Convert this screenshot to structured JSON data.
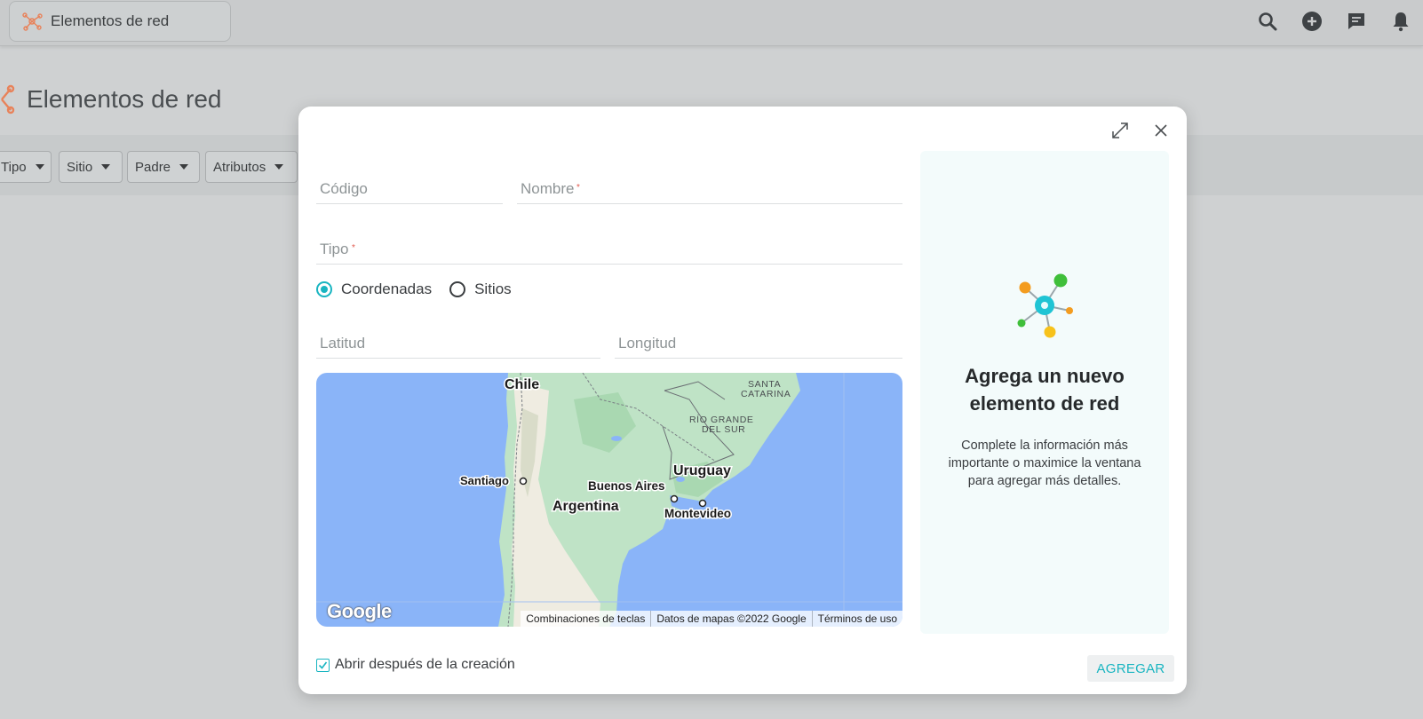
{
  "app": {
    "chip_label": "Elementos de red",
    "chip_icon": "network-nodes-icon"
  },
  "top_icons": [
    "search-icon",
    "add-circle-icon",
    "chat-icon",
    "bell-icon"
  ],
  "page": {
    "title": "Elementos de red",
    "title_icon": "network-nodes-icon"
  },
  "filters": [
    {
      "label": "Tipo"
    },
    {
      "label": "Sitio"
    },
    {
      "label": "Padre"
    },
    {
      "label": "Atributos"
    }
  ],
  "modal": {
    "fields": {
      "codigo_placeholder": "Código",
      "nombre_placeholder": "Nombre",
      "tipo_placeholder": "Tipo",
      "latitud_placeholder": "Latitud",
      "longitud_placeholder": "Longitud",
      "required_marker": "*"
    },
    "location_mode": {
      "options": [
        "Coordenadas",
        "Sitios"
      ],
      "selected": "Coordenadas"
    },
    "map": {
      "labels": {
        "chile": "Chile",
        "santiago": "Santiago",
        "argentina": "Argentina",
        "buenos_aires": "Buenos Aires",
        "uruguay": "Uruguay",
        "montevideo": "Montevideo",
        "rio_grande_1": "RÍO GRANDE",
        "rio_grande_2": "DEL SUR",
        "santa_catarina_1": "SANTA",
        "santa_catarina_2": "CATARINA"
      },
      "logo": "Google",
      "footer": {
        "shortcuts": "Combinaciones de teclas",
        "data": "Datos de mapas ©2022 Google",
        "terms": "Términos de uso"
      }
    },
    "info": {
      "title_line1": "Agrega un nuevo",
      "title_line2": "elemento de red",
      "text": "Complete la información más importante o maximice la ventana para agregar más detalles."
    },
    "open_after_label": "Abrir después de la creación",
    "open_after_checked": true,
    "add_label": "AGREGAR"
  },
  "colors": {
    "accent": "#19b5c1",
    "brand_icon": "#e8825a",
    "required": "#e25a4f"
  }
}
